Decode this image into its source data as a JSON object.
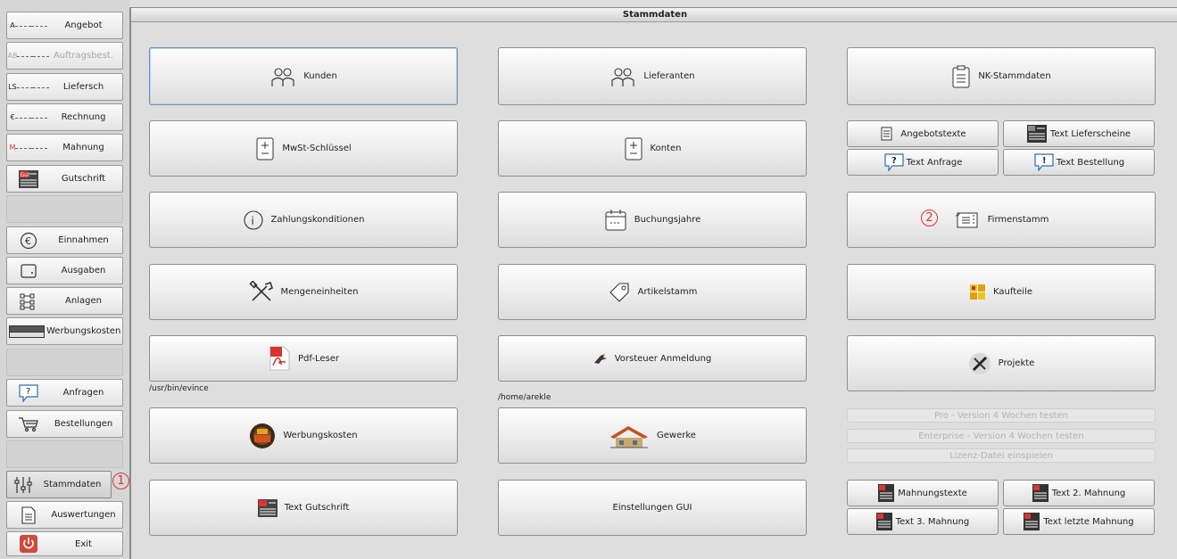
{
  "sidebar": {
    "items": [
      {
        "label": "Angebot",
        "icon_text": "A"
      },
      {
        "label": "Auftragsbest.",
        "icon_text": "AB"
      },
      {
        "label": "Liefersch",
        "icon_text": "LS"
      },
      {
        "label": "Rechnung",
        "icon_text": "€"
      },
      {
        "label": "Mahnung",
        "icon_text": "M"
      },
      {
        "label": "Gutschrift",
        "icon_text": "Gut"
      },
      {
        "label": "Einnahmen"
      },
      {
        "label": "Ausgaben"
      },
      {
        "label": "Anlagen"
      },
      {
        "label": "Werbungskosten"
      },
      {
        "label": "Anfragen"
      },
      {
        "label": "Bestellungen"
      },
      {
        "label": "Stammdaten"
      },
      {
        "label": "Auswertungen"
      },
      {
        "label": "Exit"
      }
    ]
  },
  "panel": {
    "title": "Stammdaten",
    "buttons": {
      "kunden": "Kunden",
      "lieferanten": "Lieferanten",
      "nk": "NK-Stammdaten",
      "mwst": "MwSt-Schlüssel",
      "konten": "Konten",
      "angebotstexte": "Angebotstexte",
      "text_lieferscheine": "Text Lieferscheine",
      "text_anfrage": "Text Anfrage",
      "text_bestellung": "Text Bestellung",
      "zahlung": "Zahlungskonditionen",
      "buchungsjahre": "Buchungsjahre",
      "firmenstamm": "Firmenstamm",
      "mengen": "Mengeneinheiten",
      "artikel": "Artikelstamm",
      "kaufteile": "Kaufteile",
      "pdf": "Pdf-Leser",
      "vorsteuer": "Vorsteuer Anmeldung",
      "projekte": "Projekte",
      "werbung": "Werbungskosten",
      "gewerke": "Gewerke",
      "pro": "Pro - Version 4 Wochen testen",
      "enterprise": "Enterprise - Version 4 Wochen testen",
      "lizenz": "Lizenz-Datei einspielen",
      "text_gutschrift": "Text Gutschrift",
      "einstellungen": "Einstellungen GUI",
      "mahnungstexte": "Mahnungstexte",
      "text_2_mahnung": "Text 2. Mahnung",
      "text_3_mahnung": "Text 3. Mahnung",
      "text_letzte_mahnung": "Text letzte Mahnung"
    },
    "paths": {
      "pdf": "/usr/bin/evince",
      "vorsteuer": "/home/arekle"
    }
  },
  "markers": {
    "one": "1",
    "two": "2"
  },
  "colors": {
    "accent_red": "#dd3333",
    "focus_border": "#6d8fb8"
  }
}
